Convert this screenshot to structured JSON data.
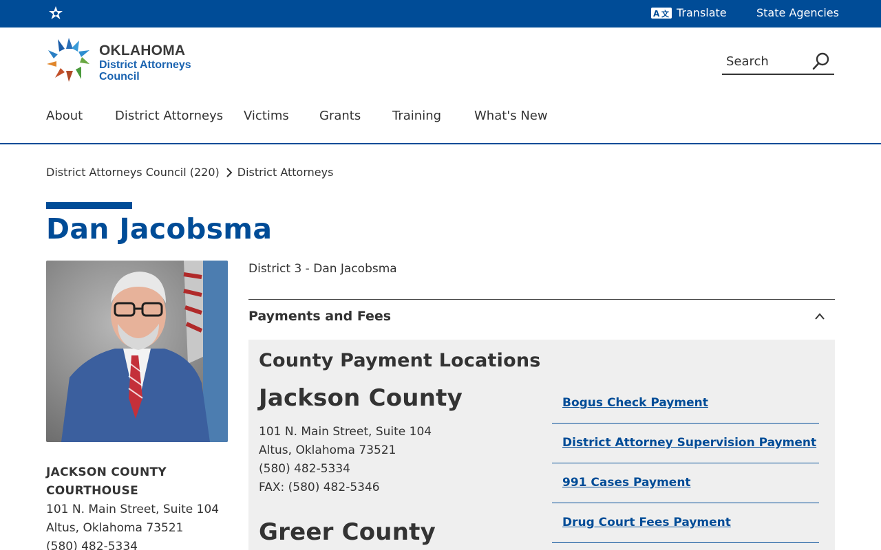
{
  "topbar": {
    "translate": "Translate",
    "state_agencies": "State Agencies"
  },
  "logo": {
    "line1": "OKLAHOMA",
    "line2": "District Attorneys",
    "line3": "Council"
  },
  "search": {
    "placeholder": "Search"
  },
  "nav": [
    "About",
    "District Attorneys",
    "Victims",
    "Grants",
    "Training",
    "What's New"
  ],
  "breadcrumb": [
    "District Attorneys Council (220)",
    "District Attorneys"
  ],
  "page_title": "Dan Jacobsma",
  "left_address": {
    "line1": "JACKSON COUNTY",
    "line2": "COURTHOUSE",
    "street": "101 N. Main Street, Suite 104",
    "city": "Altus, Oklahoma 73521",
    "phone": "(580) 482-5334"
  },
  "district_line": "District 3 - Dan Jacobsma",
  "accordion": {
    "label": "Payments and Fees"
  },
  "panel": {
    "heading": "County Payment Locations",
    "jackson": {
      "name": "Jackson County",
      "street": "101 N. Main Street, Suite 104",
      "city": "Altus, Oklahoma 73521",
      "phone": "(580) 482-5334",
      "fax": "FAX: (580) 482-5346"
    },
    "greer": {
      "name": "Greer County"
    },
    "links": [
      "Bogus Check Payment",
      "District Attorney Supervision Payment",
      "991 Cases Payment",
      "Drug Court Fees Payment"
    ]
  },
  "colors": {
    "primary": "#004c97",
    "panel_bg": "#efefef",
    "text": "#333333"
  }
}
